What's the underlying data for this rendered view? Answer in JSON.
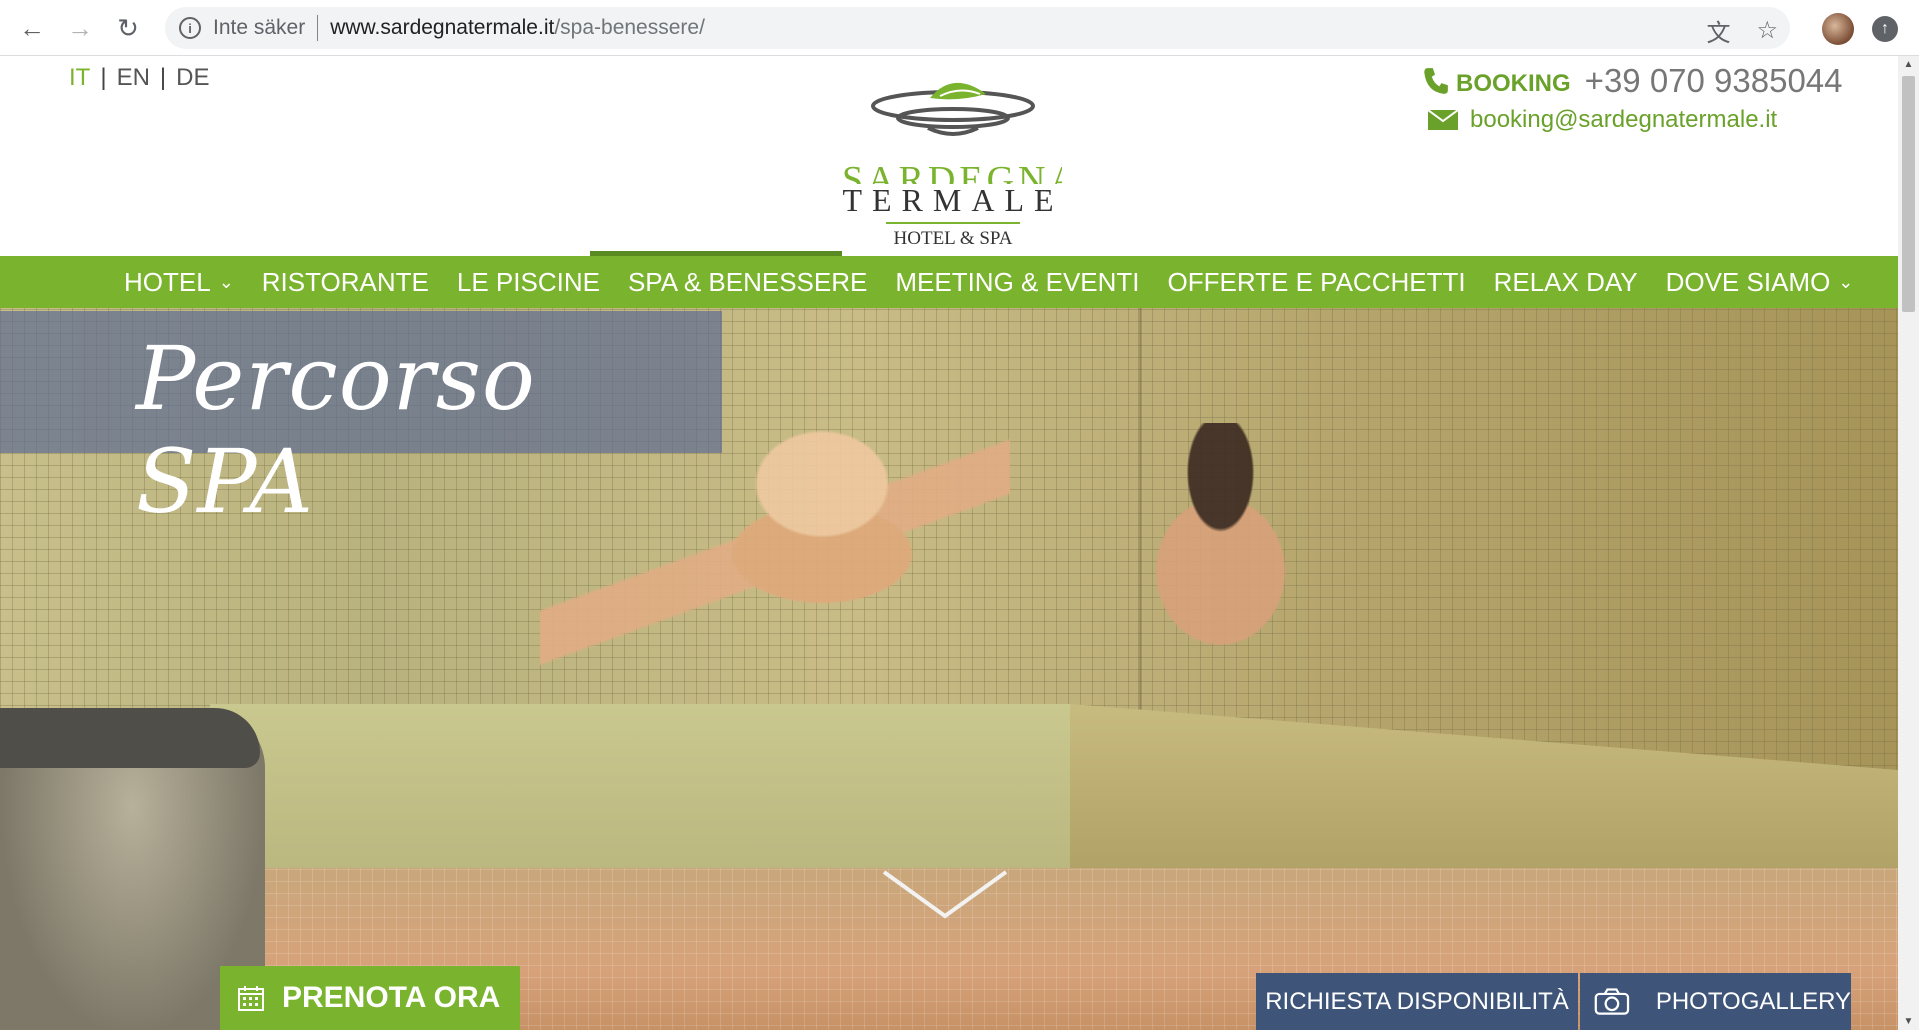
{
  "browser": {
    "security_label": "Inte säker",
    "url_domain": "www.sardegnatermale.it",
    "url_path": "/spa-benessere/"
  },
  "header": {
    "languages": [
      "IT",
      "EN",
      "DE"
    ],
    "active_language": "IT",
    "logo": {
      "line1": "SARDEGNA",
      "line2": "TERMALE",
      "line3": "HOTEL & SPA"
    },
    "booking_label": "BOOKING",
    "phone": "+39 070 9385044",
    "email": "booking@sardegnatermale.it"
  },
  "nav": {
    "items": [
      {
        "label": "HOTEL",
        "has_dropdown": true
      },
      {
        "label": "RISTORANTE",
        "has_dropdown": false
      },
      {
        "label": "LE PISCINE",
        "has_dropdown": false
      },
      {
        "label": "SPA & BENESSERE",
        "has_dropdown": false,
        "active": true
      },
      {
        "label": "MEETING & EVENTI",
        "has_dropdown": false
      },
      {
        "label": "OFFERTE E PACCHETTI",
        "has_dropdown": false
      },
      {
        "label": "RELAX DAY",
        "has_dropdown": false
      },
      {
        "label": "DOVE SIAMO",
        "has_dropdown": true
      }
    ]
  },
  "hero": {
    "title": "Percorso SPA",
    "prenota_label": "PRENOTA ORA",
    "richiesta_label": "RICHIESTA DISPONIBILITÀ",
    "photogallery_label": "PHOTOGALLERY"
  },
  "colors": {
    "brand_green": "#7ab32e",
    "button_blue": "#3e5478",
    "banner_overlay": "#5f6e91"
  }
}
